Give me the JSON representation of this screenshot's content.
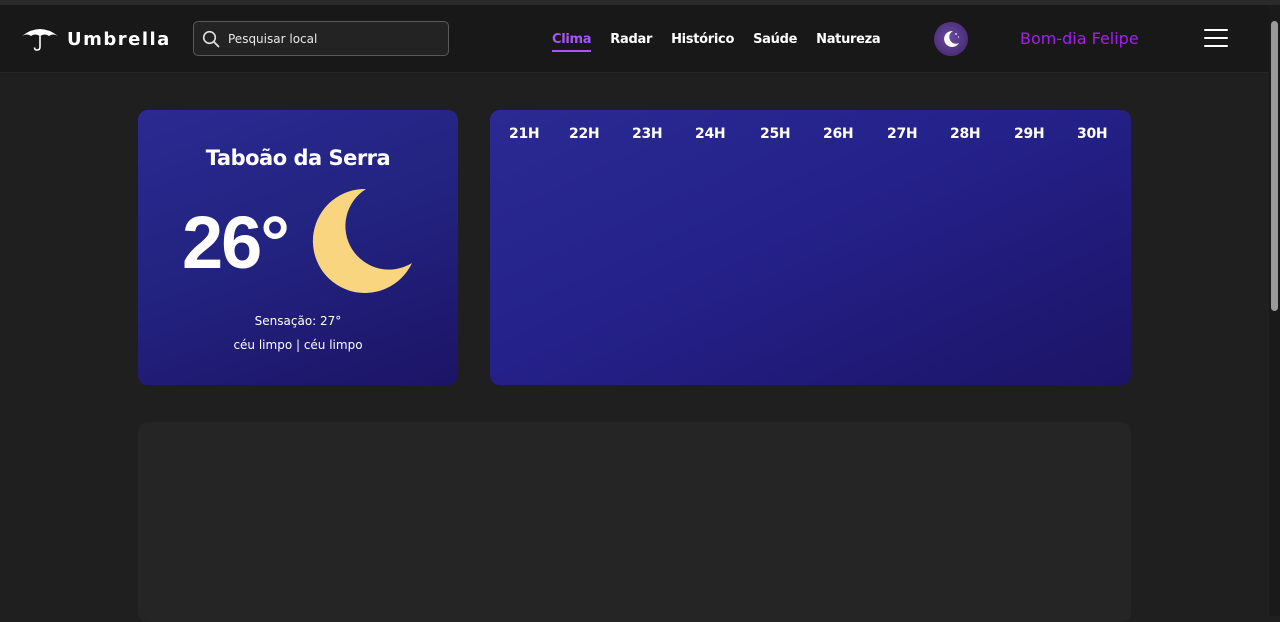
{
  "app": {
    "name": "Umbrella"
  },
  "search": {
    "placeholder": "Pesquisar local"
  },
  "nav": {
    "items": [
      {
        "label": "Clima",
        "active": true
      },
      {
        "label": "Radar",
        "active": false
      },
      {
        "label": "Histórico",
        "active": false
      },
      {
        "label": "Saúde",
        "active": false
      },
      {
        "label": "Natureza",
        "active": false
      }
    ]
  },
  "header": {
    "theme_icon": "moon-icon",
    "greeting": "Bom-dia Felipe",
    "menu_icon": "hamburger-menu-icon"
  },
  "current": {
    "city": "Taboão da Serra",
    "temperature": "26°",
    "condition_icon": "crescent-moon-icon",
    "feels_like": "Sensação: 27°",
    "description": "céu limpo | céu limpo"
  },
  "hourly": {
    "hours": [
      "21H",
      "22H",
      "23H",
      "24H",
      "25H",
      "26H",
      "27H",
      "28H",
      "29H",
      "30H"
    ]
  },
  "colors": {
    "accent": "#a855f7",
    "greeting": "#a020f0",
    "card_bg": "#22227f",
    "moon": "#f8d57e"
  }
}
